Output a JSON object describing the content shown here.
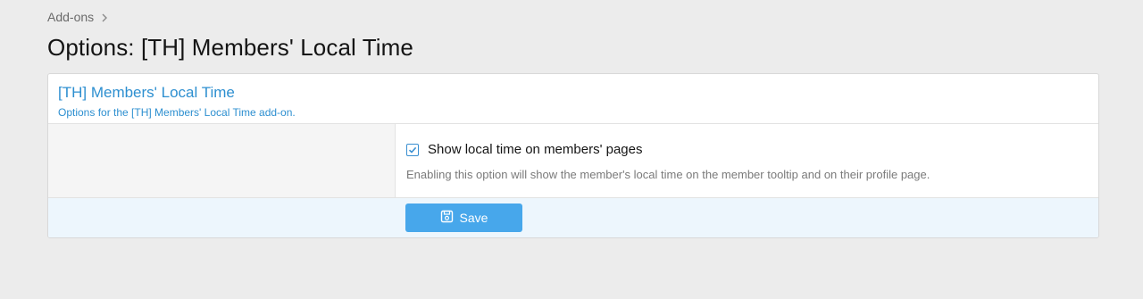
{
  "breadcrumb": {
    "items": [
      "Add-ons"
    ],
    "separator_icon": "chevron-right-icon"
  },
  "page": {
    "title": "Options: [TH] Members' Local Time"
  },
  "block": {
    "title": "[TH] Members' Local Time",
    "description": "Options for the [TH] Members' Local Time add-on."
  },
  "option": {
    "checked": true,
    "label": "Show local time on members' pages",
    "hint": "Enabling this option will show the member's local time on the member tooltip and on their profile page."
  },
  "footer": {
    "save_label": "Save",
    "save_icon": "save-icon"
  },
  "colors": {
    "accent": "#2d8fd0",
    "button": "#47a7eb",
    "footer_bg": "#edf6fd",
    "page_bg": "#ececec"
  }
}
